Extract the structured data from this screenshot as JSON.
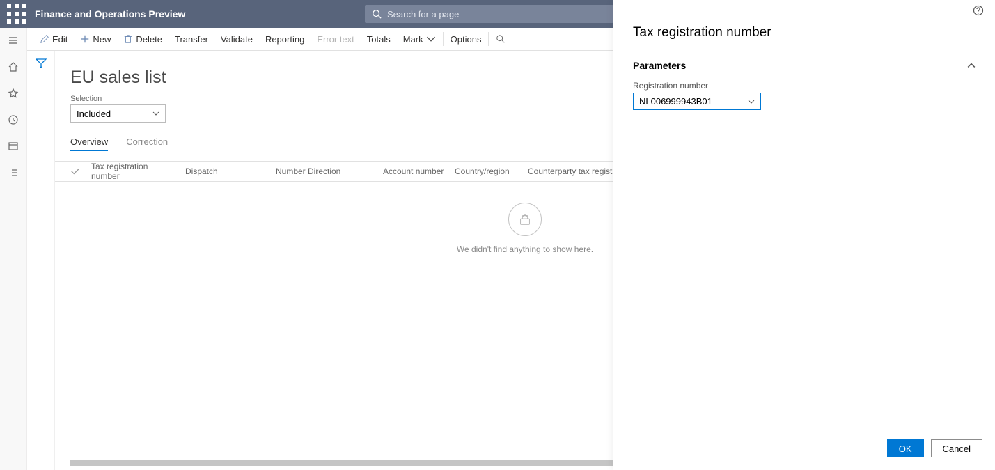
{
  "header": {
    "app_title": "Finance and Operations Preview",
    "search_placeholder": "Search for a page"
  },
  "action_bar": {
    "edit": "Edit",
    "new": "New",
    "delete": "Delete",
    "transfer": "Transfer",
    "validate": "Validate",
    "reporting": "Reporting",
    "error_text": "Error text",
    "totals": "Totals",
    "mark": "Mark",
    "options": "Options"
  },
  "page": {
    "title": "EU sales list",
    "selection_label": "Selection",
    "selection_value": "Included",
    "tabs": {
      "overview": "Overview",
      "correction": "Correction"
    },
    "columns": {
      "tax_reg": "Tax registration number",
      "dispatch": "Dispatch",
      "number": "Number",
      "direction": "Direction",
      "account": "Account number",
      "country": "Country/region",
      "cp_tax": "Counterparty tax registration"
    },
    "empty_text": "We didn't find anything to show here."
  },
  "flyout": {
    "title": "Tax registration number",
    "section": "Parameters",
    "field_label": "Registration number",
    "field_value": "NL006999943B01",
    "ok": "OK",
    "cancel": "Cancel"
  }
}
